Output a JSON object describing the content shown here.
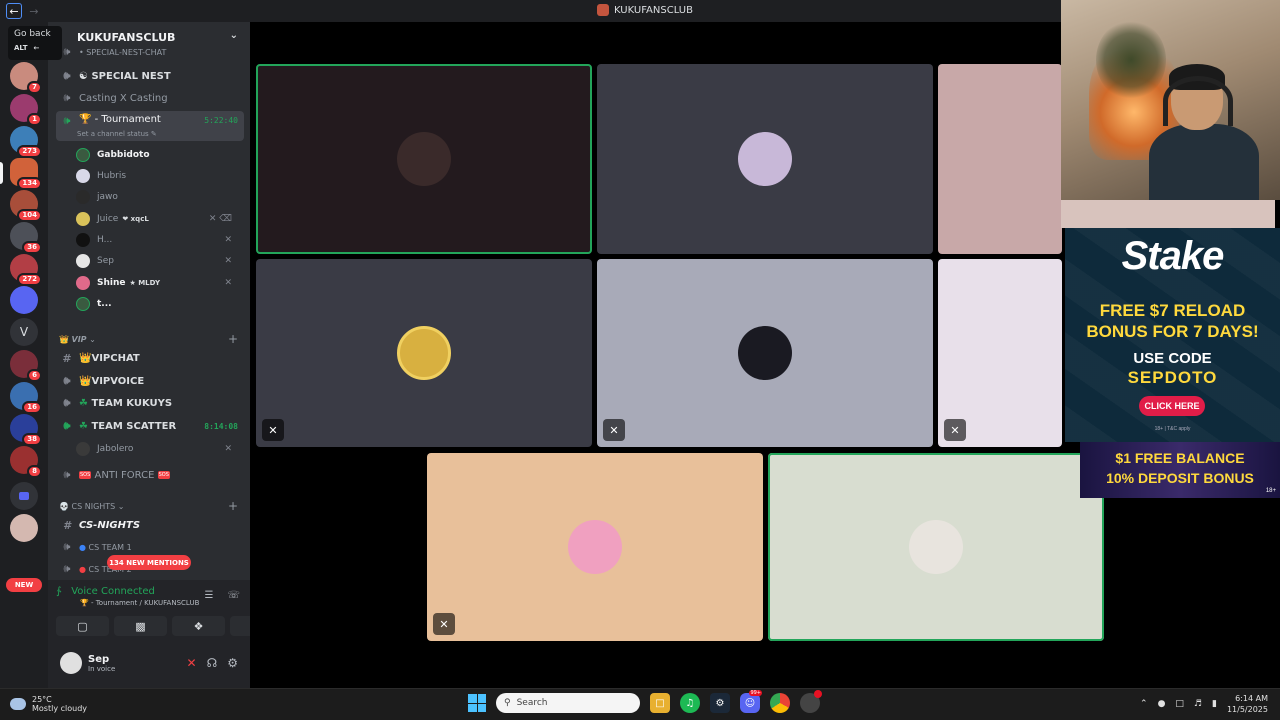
{
  "window": {
    "title": "KUKUFANSCLUB",
    "back_tooltip": "Go back",
    "tooltip_key": "ALT"
  },
  "server_rail": {
    "badges": [
      "7",
      "1",
      "273",
      "134",
      "104",
      "36",
      "272",
      "6",
      "16",
      "38",
      "8"
    ],
    "letter_server": "V",
    "new_label": "NEW"
  },
  "guild": {
    "name": "KUKUFANSCLUB",
    "channels": [
      {
        "name": "SPECIAL-NEST-CHAT",
        "prefix": "•"
      },
      {
        "name": "SPECIAL NEST",
        "prefix": "☯"
      },
      {
        "name": "Casting X Casting",
        "prefix": ""
      },
      {
        "name": "- Tournament",
        "prefix": "🏆",
        "time": "5:22:40"
      },
      {
        "name": "VIPCHAT",
        "prefix": "👑"
      },
      {
        "name": "VIPVOICE",
        "prefix": "👑"
      },
      {
        "name": "TEAM KUKUYS",
        "prefix": "☘"
      },
      {
        "name": "TEAM SCATTER",
        "prefix": "☘",
        "time": "8:14:08"
      },
      {
        "name": "ANTI FORCE",
        "prefix": "SOS",
        "suffix": "SOS"
      },
      {
        "name": "CS-NIGHTS",
        "prefix": ""
      },
      {
        "name": "CS TEAM 1",
        "prefix": "●"
      },
      {
        "name": "CS TEAM 2",
        "prefix": "●"
      }
    ],
    "channel_status": "Set a channel status",
    "categories": [
      {
        "name": "VIP",
        "prefix": "👑"
      },
      {
        "name": "CS NIGHTS",
        "prefix": "💀"
      }
    ],
    "tournament_users": [
      {
        "name": "Gabbidoto"
      },
      {
        "name": "Hubris"
      },
      {
        "name": "jawo"
      },
      {
        "name": "Juice",
        "tag": "xqcL"
      },
      {
        "name": "H..."
      },
      {
        "name": "Sep"
      },
      {
        "name": "Shine",
        "tag": "MLDY"
      },
      {
        "name": "t..."
      }
    ],
    "scatter_users": [
      {
        "name": "Jabolero"
      }
    ],
    "mentions_badge": "134 NEW MENTIONS"
  },
  "voice_panel": {
    "status": "Voice Connected",
    "location": "- Tournament / KUKUFANSCLUB",
    "user_name": "Sep",
    "user_status": "In voice"
  },
  "ads": {
    "stake_logo": "Stake",
    "offer_line1": "FREE $7 RELOAD",
    "offer_line2": "BONUS FOR 7 DAYS!",
    "use_code": "USE CODE",
    "code": "SEPDOTO",
    "cta": "CLICK HERE",
    "fine_print": "18+ | T&C apply",
    "banner_line1": "$1 FREE BALANCE",
    "banner_line2": "10% DEPOSIT BONUS",
    "banner_age": "18+"
  },
  "taskbar": {
    "temperature": "25°C",
    "weather": "Mostly cloudy",
    "search_placeholder": "Search",
    "discord_badge": "99+",
    "time": "6:14 AM",
    "date": "11/5/2025"
  },
  "colors": {
    "discord_green": "#23a55a",
    "discord_red": "#f23f43",
    "sidebar_bg": "#2b2d31",
    "stake_yellow": "#ffd93d"
  }
}
